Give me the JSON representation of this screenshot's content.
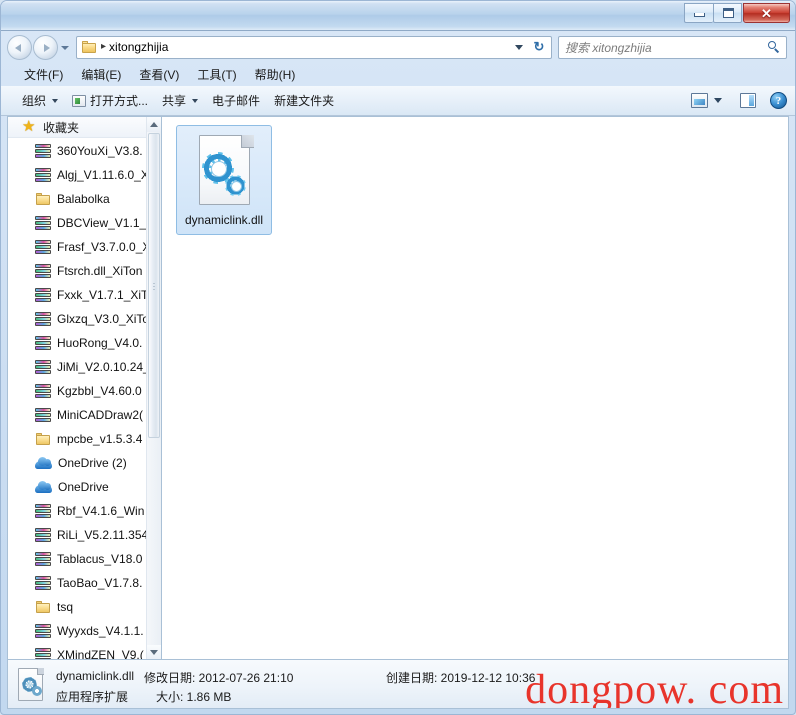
{
  "window": {
    "controls": {
      "minimize": "–",
      "maximize": "□",
      "close": "✕"
    }
  },
  "address": {
    "folder_icon": "folder-icon",
    "separator": "▸",
    "path": "xitongzhijia",
    "dropdown_icon": "chevron-down-icon",
    "refresh_icon": "refresh-icon",
    "refresh_glyph": "↻"
  },
  "search": {
    "placeholder": "搜索 xitongzhijia",
    "icon": "search-icon"
  },
  "menubar": {
    "items": [
      {
        "label": "文件(F)"
      },
      {
        "label": "编辑(E)"
      },
      {
        "label": "查看(V)"
      },
      {
        "label": "工具(T)"
      },
      {
        "label": "帮助(H)"
      }
    ]
  },
  "toolbar": {
    "organize": "组织",
    "open_with": "打开方式...",
    "share": "共享",
    "email": "电子邮件",
    "new_folder": "新建文件夹",
    "help_glyph": "?"
  },
  "sidebar": {
    "header": "收藏夹",
    "header_icon": "star-icon",
    "star_glyph": "★",
    "items": [
      {
        "label": "360YouXi_V3.8.",
        "icon": "archive-icon"
      },
      {
        "label": "Algj_V1.11.6.0_X",
        "icon": "archive-icon"
      },
      {
        "label": "Balabolka",
        "icon": "folder-icon"
      },
      {
        "label": "DBCView_V1.1_",
        "icon": "archive-icon"
      },
      {
        "label": "Frasf_V3.7.0.0_X",
        "icon": "archive-icon"
      },
      {
        "label": "Ftsrch.dll_XiTon",
        "icon": "archive-icon"
      },
      {
        "label": "Fxxk_V1.7.1_XiT",
        "icon": "archive-icon"
      },
      {
        "label": "Glxzq_V3.0_XiTo",
        "icon": "archive-icon"
      },
      {
        "label": "HuoRong_V4.0.",
        "icon": "archive-icon"
      },
      {
        "label": "JiMi_V2.0.10.24_",
        "icon": "archive-icon"
      },
      {
        "label": "Kgzbbl_V4.60.0",
        "icon": "archive-icon"
      },
      {
        "label": "MiniCADDraw2(",
        "icon": "archive-icon"
      },
      {
        "label": "mpcbe_v1.5.3.4",
        "icon": "folder-icon"
      },
      {
        "label": "OneDrive (2)",
        "icon": "cloud-icon"
      },
      {
        "label": "OneDrive",
        "icon": "cloud-icon"
      },
      {
        "label": "Rbf_V4.1.6_Win",
        "icon": "archive-icon"
      },
      {
        "label": "RiLi_V5.2.11.354",
        "icon": "archive-icon"
      },
      {
        "label": "Tablacus_V18.0",
        "icon": "archive-icon"
      },
      {
        "label": "TaoBao_V1.7.8.",
        "icon": "archive-icon"
      },
      {
        "label": "tsq",
        "icon": "folder-icon"
      },
      {
        "label": "Wyyxds_V4.1.1.",
        "icon": "archive-icon"
      },
      {
        "label": "XMindZEN_V9.(",
        "icon": "archive-icon"
      }
    ]
  },
  "content": {
    "files": [
      {
        "name": "dynamiclink.dll",
        "icon": "dll-file-icon",
        "selected": true
      }
    ]
  },
  "statusbar": {
    "file_name": "dynamiclink.dll",
    "modified_label": "修改日期:",
    "modified_value": "2012-07-26 21:10",
    "created_label": "创建日期:",
    "created_value": "2019-12-12 10:36",
    "file_type": "应用程序扩展",
    "size_label": "大小:",
    "size_value": "1.86 MB",
    "modified_full": "修改日期: 2012-07-26 21:10",
    "created_full": "创建日期: 2019-12-12 10:36",
    "size_full": "大小: 1.86 MB"
  },
  "watermark": {
    "text": "dongpow. com",
    "color": "#e8342b"
  }
}
